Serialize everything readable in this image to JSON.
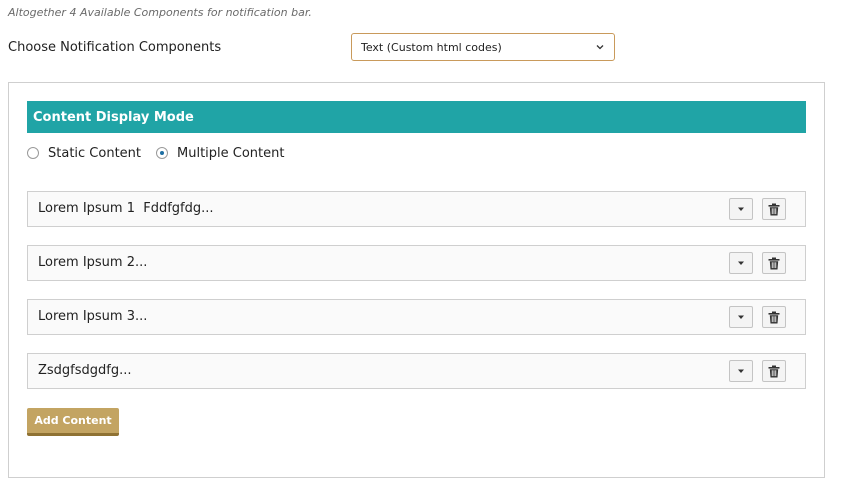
{
  "help_text": "Altogether 4 Available Components for notification bar.",
  "components": {
    "label": "Choose Notification Components",
    "selected": "Text (Custom html codes)"
  },
  "panel": {
    "header": "Content Display Mode",
    "modes": [
      {
        "label": "Static Content",
        "checked": false
      },
      {
        "label": "Multiple Content",
        "checked": true
      }
    ],
    "items": [
      {
        "label": "Lorem Ipsum 1  Fddfgfdg..."
      },
      {
        "label": "Lorem Ipsum 2..."
      },
      {
        "label": "Lorem Ipsum 3..."
      },
      {
        "label": "Zsdgfsdgdfg..."
      }
    ],
    "add_button": "Add Content"
  },
  "colors": {
    "header_bg": "#20a4a6",
    "accent_border": "#c99a5b",
    "add_button_bg": "#c3a462",
    "radio_dot": "#1e6fa3"
  },
  "icons": {
    "select": "chevron-down-icon",
    "item_toggle": "caret-down-icon",
    "item_delete": "trash-icon"
  }
}
